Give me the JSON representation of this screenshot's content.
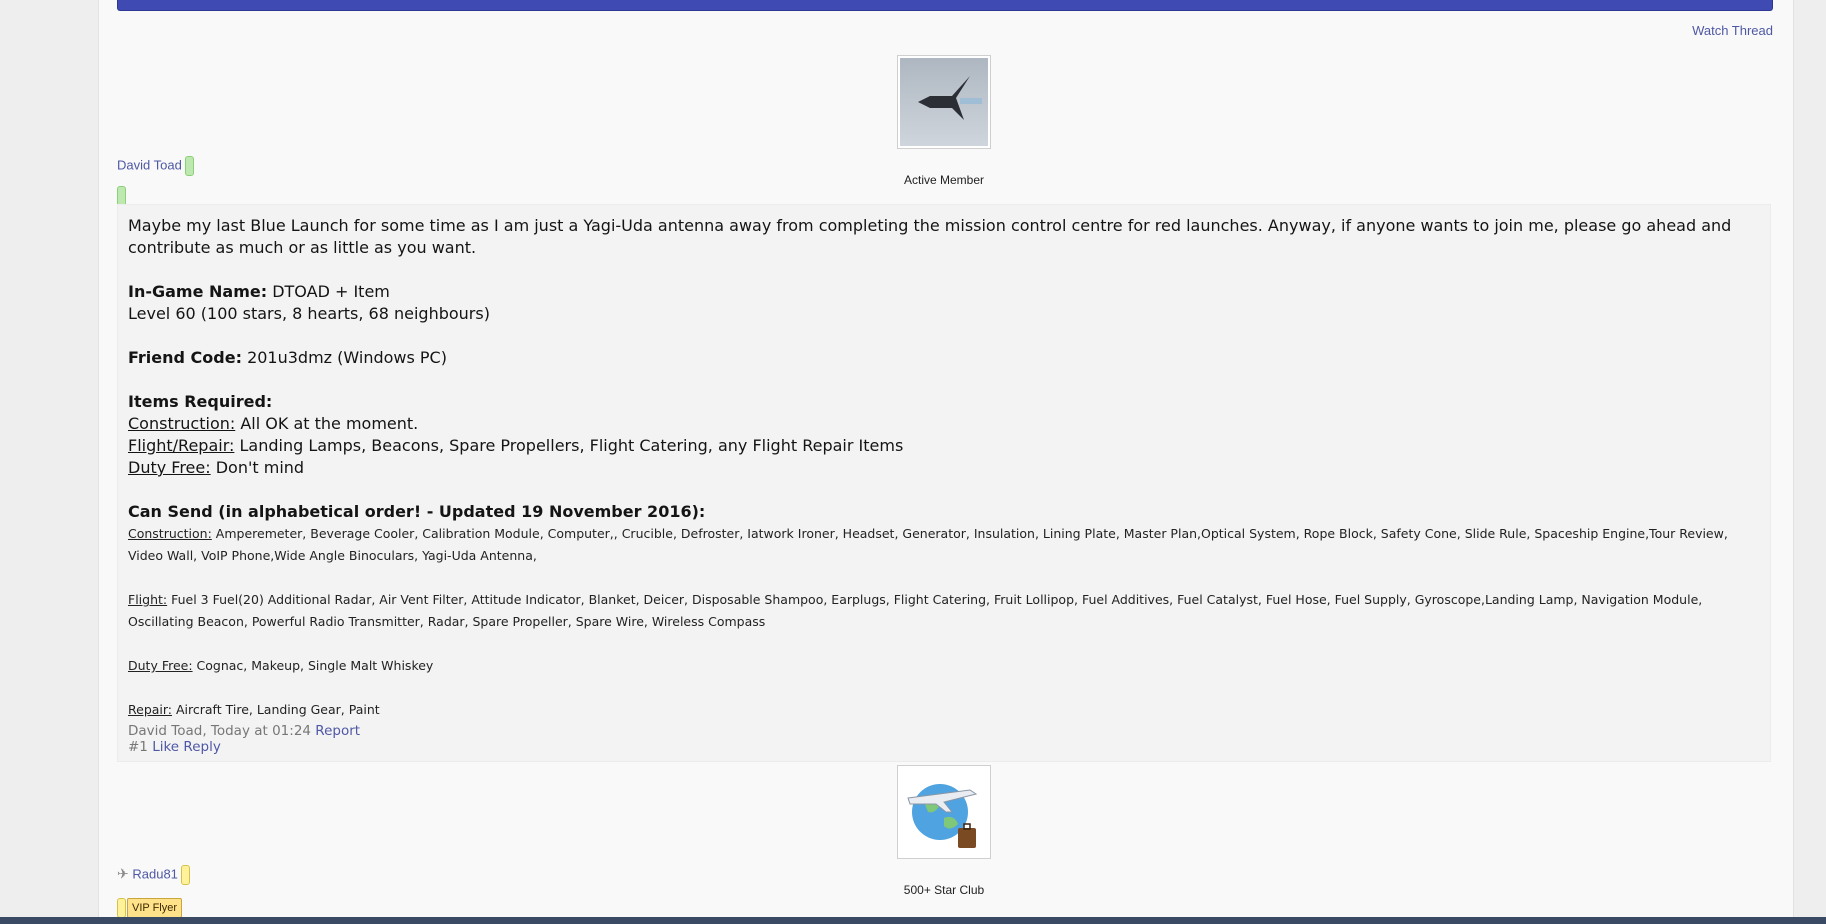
{
  "thread": {
    "watch_label": "Watch Thread"
  },
  "post1": {
    "username": "David Toad",
    "user_title": "Active Member",
    "intro": "Maybe my last Blue Launch for some time as I am just a Yagi-Uda antenna away from completing the mission control centre for red launches. Anyway, if anyone wants to join me, please go ahead and contribute as much or as little as you want.",
    "ign_label": "In-Game Name:",
    "ign_value": " DTOAD + Item",
    "level": "Level 60 (100 stars, 8 hearts, 68 neighbours)",
    "friend_label": "Friend Code:",
    "friend_value": " 201u3dmz (Windows PC)",
    "items_heading": "Items Required:",
    "req_construction_label": "Construction:",
    "req_construction_value": " All OK at the moment.",
    "req_flight_label": "Flight/Repair:",
    "req_flight_value": " Landing Lamps, Beacons, Spare Propellers, Flight Catering, any Flight Repair Items",
    "req_duty_label": "Duty Free:",
    "req_duty_value": " Don't mind",
    "can_send_heading": "Can Send (in alphabetical order! - Updated 19 November 2016):",
    "send_construction_label": "Construction:",
    "send_construction_value": " Amperemeter, Beverage Cooler, Calibration Module, Computer,, Crucible, Defroster, Iatwork Ironer, Headset, Generator, Insulation, Lining Plate, Master Plan,Optical System, Rope Block, Safety Cone, Slide Rule, Spaceship Engine,Tour Review, Video Wall, VoIP Phone,Wide Angle Binoculars, Yagi-Uda Antenna,",
    "send_flight_label": "Flight:",
    "send_flight_value": " Fuel 3 Fuel(20) Additional Radar, Air Vent Filter, Attitude Indicator, Blanket, Deicer, Disposable Shampoo, Earplugs, Flight Catering, Fruit Lollipop, Fuel Additives, Fuel Catalyst, Fuel Hose, Fuel Supply, Gyroscope,Landing Lamp, Navigation Module, Oscillating Beacon, Powerful Radio Transmitter, Radar, Spare Propeller, Spare Wire, Wireless Compass",
    "send_duty_label": "Duty Free:",
    "send_duty_value": " Cognac, Makeup, Single Malt Whiskey",
    "send_repair_label": "Repair:",
    "send_repair_value": " Aircraft Tire, Landing Gear, Paint",
    "meta_author_time": "David Toad, Today at 01:24 ",
    "report_label": "Report",
    "post_number": "#1 ",
    "like_label": "Like",
    "reply_label": "Reply"
  },
  "post2": {
    "username": "Radu81",
    "user_title": "500+ Star Club",
    "badge": "VIP Flyer"
  },
  "colors": {
    "topbar": "#3f4bb3",
    "link": "#4f58a5",
    "badge": "#ffe28a"
  },
  "icons": [
    "airplane-avatar",
    "globe-plane-avatar",
    "plane-small-icon"
  ]
}
